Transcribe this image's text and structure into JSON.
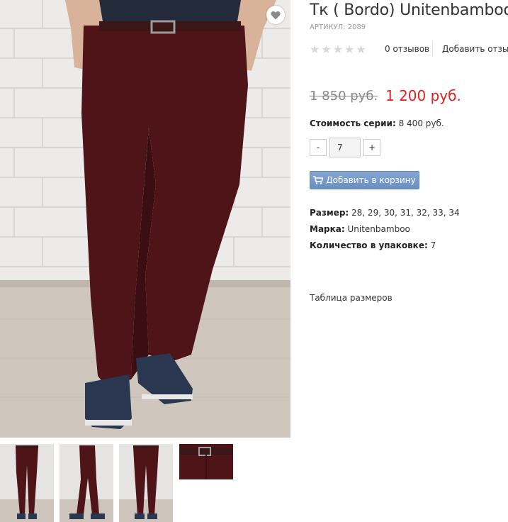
{
  "product": {
    "title": "Тк ( Bordo) Unitenbamboo",
    "sku": "АРТИКУЛ: 2089",
    "reviews_count": "0 отзывов",
    "add_review": "Добавить отзыв",
    "rating_stars": 0,
    "price_old": "1 850 руб.",
    "price_new": "1 200 руб.",
    "series_label": "Стоимость серии:",
    "series_value": "8 400 руб.",
    "qty_minus": "-",
    "qty_value": "7",
    "qty_plus": "+",
    "add_to_cart": "Добавить в корзину",
    "size_label": "Размер:",
    "size_value": "28, 29, 30, 31, 32, 33, 34",
    "brand_label": "Марка:",
    "brand_value": "Unitenbamboo",
    "pack_label": "Количество в упаковке:",
    "pack_value": "7",
    "size_table": "Таблица размеров"
  },
  "colors": {
    "price_new": "#e31e1e",
    "cart_button": "#7297c9",
    "pants": "#4e1418"
  },
  "icons": [
    "heart-icon",
    "star-icon",
    "cart-icon"
  ]
}
